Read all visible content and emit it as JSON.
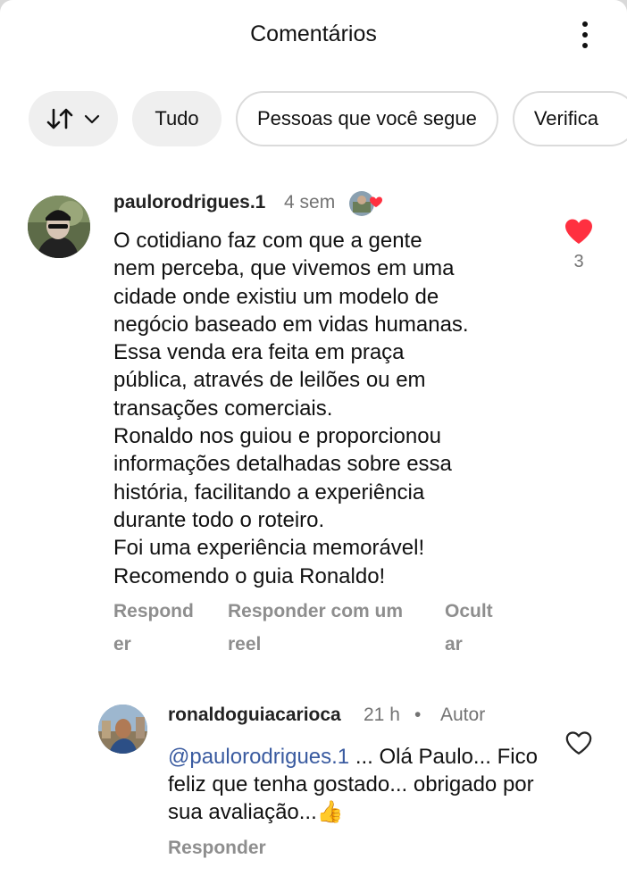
{
  "header": {
    "title": "Comentários"
  },
  "filters": {
    "all_label": "Tudo",
    "following_label": "Pessoas que você segue",
    "verified_label": "Verifica"
  },
  "comment": {
    "username": "paulorodrigues.1",
    "time": "4 sem",
    "text": "O cotidiano faz com que a gente\nnem perceba, que vivemos em uma\ncidade onde existiu um modelo de\nnegócio baseado em vidas humanas.\nEssa venda era feita em praça\npública, através de leilões ou em\ntransações comerciais.\nRonaldo nos guiou e proporcionou\ninformações detalhadas sobre essa\nhistória, facilitando a experiência\ndurante todo o roteiro.\nFoi uma experiência memorável!\nRecomendo o guia Ronaldo!",
    "like_count": "3",
    "actions": {
      "reply_line1": "Respond",
      "reply_line2": "er",
      "reel_line1": "Responder com um",
      "reel_line2": "reel",
      "hide_line1": "Ocult",
      "hide_line2": "ar"
    }
  },
  "reply": {
    "username": "ronaldoguiacarioca",
    "time": "21 h",
    "separator": "•",
    "author_label": "Autor",
    "mention": "@paulorodrigues.1",
    "text_line1": " ... Olá Paulo...",
    "text_rest": "Fico feliz que tenha gostado... obrigado por sua avaliação...",
    "emoji": "👍",
    "reply_label": "Responder"
  },
  "colors": {
    "like_red": "#ff3040",
    "mention_blue": "#3a5ba0",
    "muted_gray": "#8e8e8e"
  }
}
